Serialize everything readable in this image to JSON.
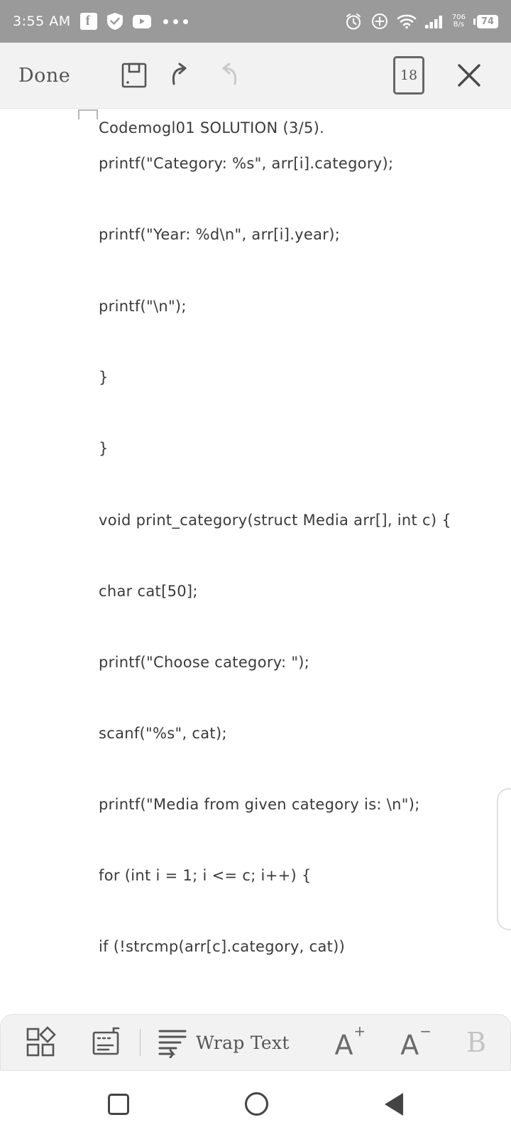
{
  "status_bar": {
    "time": "3:55 AM",
    "network_speed": "706",
    "network_speed_unit": "B/s",
    "battery_level": "74",
    "left_icons": [
      "facebook-icon",
      "shield-check-icon",
      "youtube-icon",
      "more-dots-icon"
    ],
    "right_icons": [
      "alarm-icon",
      "plus-circle-icon",
      "wifi-icon",
      "cellular-signal-icon"
    ],
    "background_color": "#9a9a9a"
  },
  "toolbar": {
    "done_label": "Done",
    "save_icon": "floppy-disk-icon",
    "undo_icon": "undo-arrow-icon",
    "redo_icon": "redo-arrow-icon",
    "page_number": "18",
    "close_icon": "close-x-icon",
    "background_color": "#f2f2f2"
  },
  "document": {
    "lines": [
      "Codemogl01 SOLUTION (3/5).",
      "printf(\"Category: %s\", arr[i].category);",
      "printf(\"Year: %d\\n\", arr[i].year);",
      "printf(\"\\n\");",
      "}",
      "}",
      "void print_category(struct Media arr[], int c) {",
      "char cat[50];",
      "printf(\"Choose category: \");",
      "scanf(\"%s\", cat);",
      "printf(\"Media from given category is: \\n\");",
      "for (int i = 1; i <= c; i++) {",
      "if (!strcmp(arr[c].category, cat))"
    ],
    "text_color": "#3a3a3a",
    "background_color": "#ffffff"
  },
  "bottom_toolbar": {
    "grid_icon": "shapes-grid-icon",
    "insert_icon": "insert-card-icon",
    "wrap_icon": "wrap-text-icon",
    "wrap_label": "Wrap Text",
    "font_increase": "A",
    "font_increase_sup": "+",
    "font_decrease": "A",
    "font_decrease_sup": "−",
    "bold_label": "B",
    "background_color": "#f2f2f2"
  },
  "nav_bar": {
    "recents_icon": "recents-square-icon",
    "home_icon": "home-circle-icon",
    "back_icon": "back-triangle-icon"
  }
}
